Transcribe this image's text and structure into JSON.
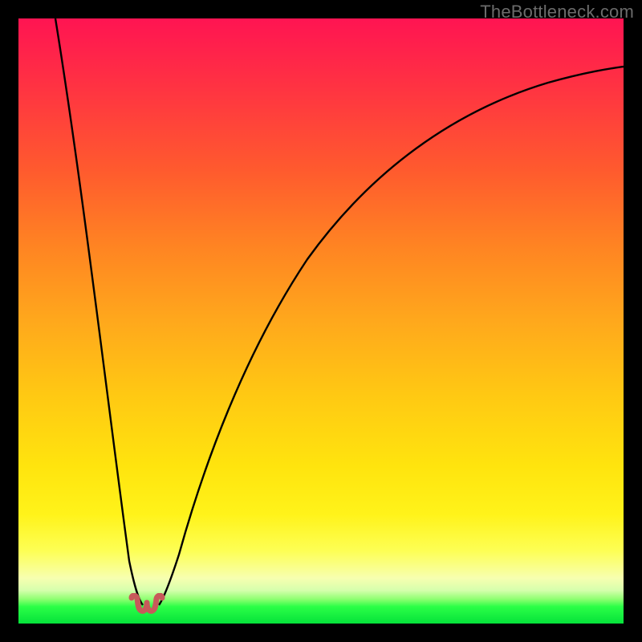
{
  "watermark": "TheBottleneck.com",
  "colors": {
    "frame": "#000000",
    "curve_stroke": "#000000",
    "squiggle": "#c75a5a",
    "gradient_top": "#ff1452",
    "gradient_mid": "#ffe40e",
    "gradient_bottom": "#05e23a"
  },
  "chart_data": {
    "type": "line",
    "title": "",
    "xlabel": "",
    "ylabel": "",
    "xlim": [
      0,
      100
    ],
    "ylim": [
      0,
      100
    ],
    "legend": false,
    "grid": false,
    "annotations": [
      {
        "text": "TheBottleneck.com",
        "position": "top-right"
      }
    ],
    "series": [
      {
        "name": "bottleneck-curve",
        "x": [
          0,
          5,
          10,
          14,
          17,
          19,
          20,
          21,
          22,
          23,
          25,
          28,
          32,
          38,
          45,
          55,
          65,
          75,
          85,
          95,
          100
        ],
        "values": [
          100,
          72,
          44,
          22,
          10,
          3,
          1,
          0,
          0,
          1,
          3,
          9,
          18,
          32,
          46,
          60,
          71,
          79,
          85,
          90,
          92
        ]
      }
    ],
    "minimum_region_x": [
      20,
      22
    ],
    "note": "Values are vertical bottleneck percentage (0 = no bottleneck / green, 100 = severe / red). Curve forms a sharp V with minimum near x≈21 and a slow asymptotic rise toward the right."
  }
}
